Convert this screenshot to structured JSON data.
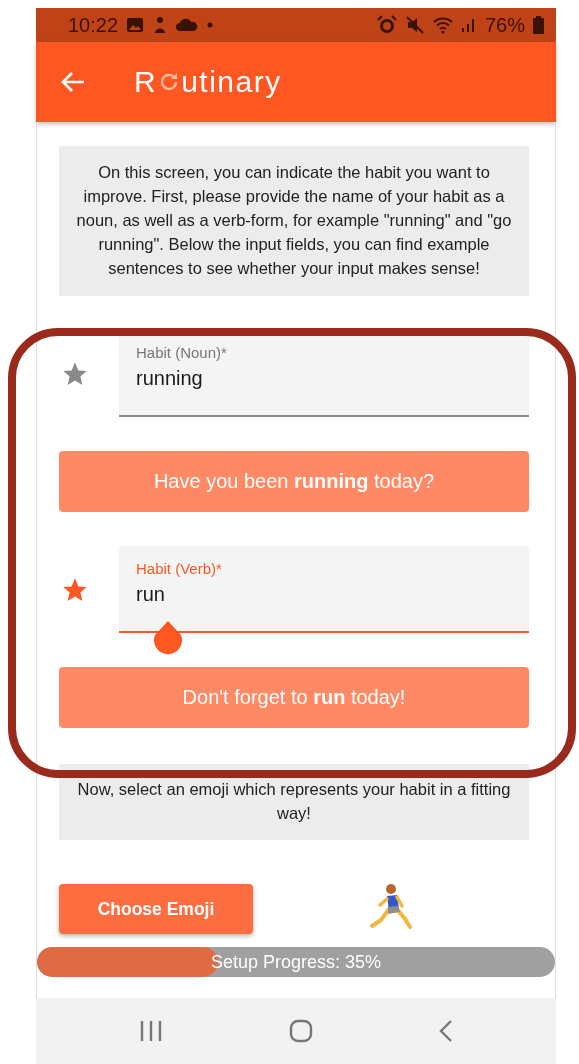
{
  "status_bar": {
    "time": "10:22",
    "battery": "76%"
  },
  "app_bar": {
    "title_start": "R",
    "title_end": "utinary"
  },
  "intro": "On this screen, you can indicate the habit you want to improve. First, please provide the name of your habit as a noun, as well as a verb-form, for example \"running\" and \"go running\". Below the input fields, you can find example sentences to see whether your input makes sense!",
  "fields": [
    {
      "label": "Habit (Noun)*",
      "value": "running",
      "focused": false,
      "example": "Have you been **running** today?"
    },
    {
      "label": "Habit (Verb)*",
      "value": "run",
      "focused": true,
      "example": "Don't forget to **run** today!"
    }
  ],
  "emoji_prompt": "Now, select an emoji which represents your habit in a fitting way!",
  "choose_button": "Choose Emoji",
  "progress": {
    "label": "Setup Progress: 35%",
    "level": 0.35
  }
}
